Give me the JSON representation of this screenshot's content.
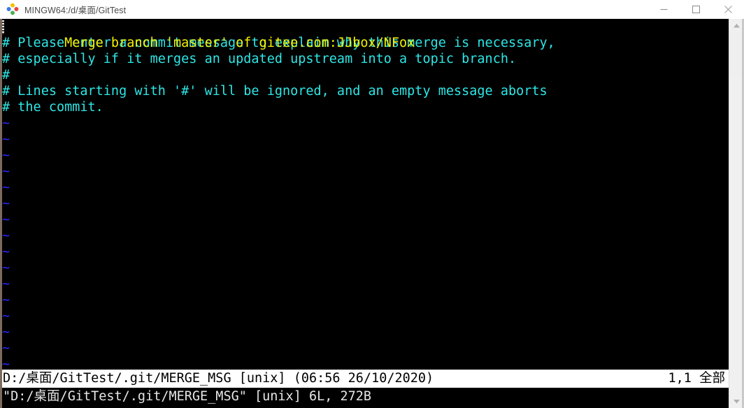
{
  "window": {
    "title": "MINGW64:/d/桌面/GitTest",
    "icon": "git-bash-icon",
    "controls": {
      "minimize": "minimize-icon",
      "maximize": "maximize-icon",
      "close": "close-icon"
    }
  },
  "editor": {
    "lines": [
      {
        "text": "Merge branch 'master' of gitee.com:JJbox/NFox",
        "color": "yellow",
        "cursor": true
      },
      {
        "text": "# Please enter a commit message to explain why this merge is necessary,",
        "color": "cyan",
        "cursor": false
      },
      {
        "text": "# especially if it merges an updated upstream into a topic branch.",
        "color": "cyan",
        "cursor": false
      },
      {
        "text": "#",
        "color": "cyan",
        "cursor": false
      },
      {
        "text": "# Lines starting with '#' will be ignored, and an empty message aborts",
        "color": "cyan",
        "cursor": false
      },
      {
        "text": "# the commit.",
        "color": "cyan",
        "cursor": false
      }
    ],
    "filler": [
      "~",
      "~",
      "~",
      "~",
      "~",
      "~",
      "~",
      "~",
      "~",
      "~",
      "~",
      "~",
      "~",
      "~",
      "~",
      "~"
    ],
    "colors": {
      "yellow": "#f2f200",
      "cyan": "#2ee6e6",
      "blue": "#2a2aff",
      "background": "#000000"
    }
  },
  "status_line": {
    "file_info": "D:/桌面/GitTest/.git/MERGE_MSG [unix] (06:56 26/10/2020)",
    "position": "1,1 全部"
  },
  "command_line": {
    "message": "\"D:/桌面/GitTest/.git/MERGE_MSG\" [unix] 6L, 272B"
  }
}
